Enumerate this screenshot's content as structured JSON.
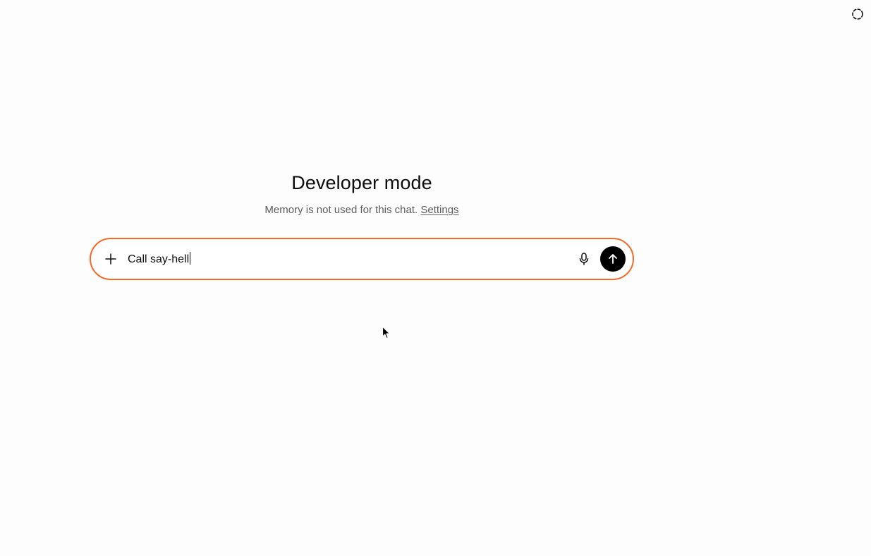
{
  "header": {
    "temporary_chat_icon": "dashed-circle-icon"
  },
  "main": {
    "title": "Developer mode",
    "subtitle_text": "Memory is not used for this chat.",
    "settings_link": "Settings"
  },
  "composer": {
    "input_value": "Call say-hell",
    "add_icon": "plus-icon",
    "mic_icon": "microphone-icon",
    "send_icon": "arrow-up-icon",
    "accent_color": "#f26b2a"
  }
}
